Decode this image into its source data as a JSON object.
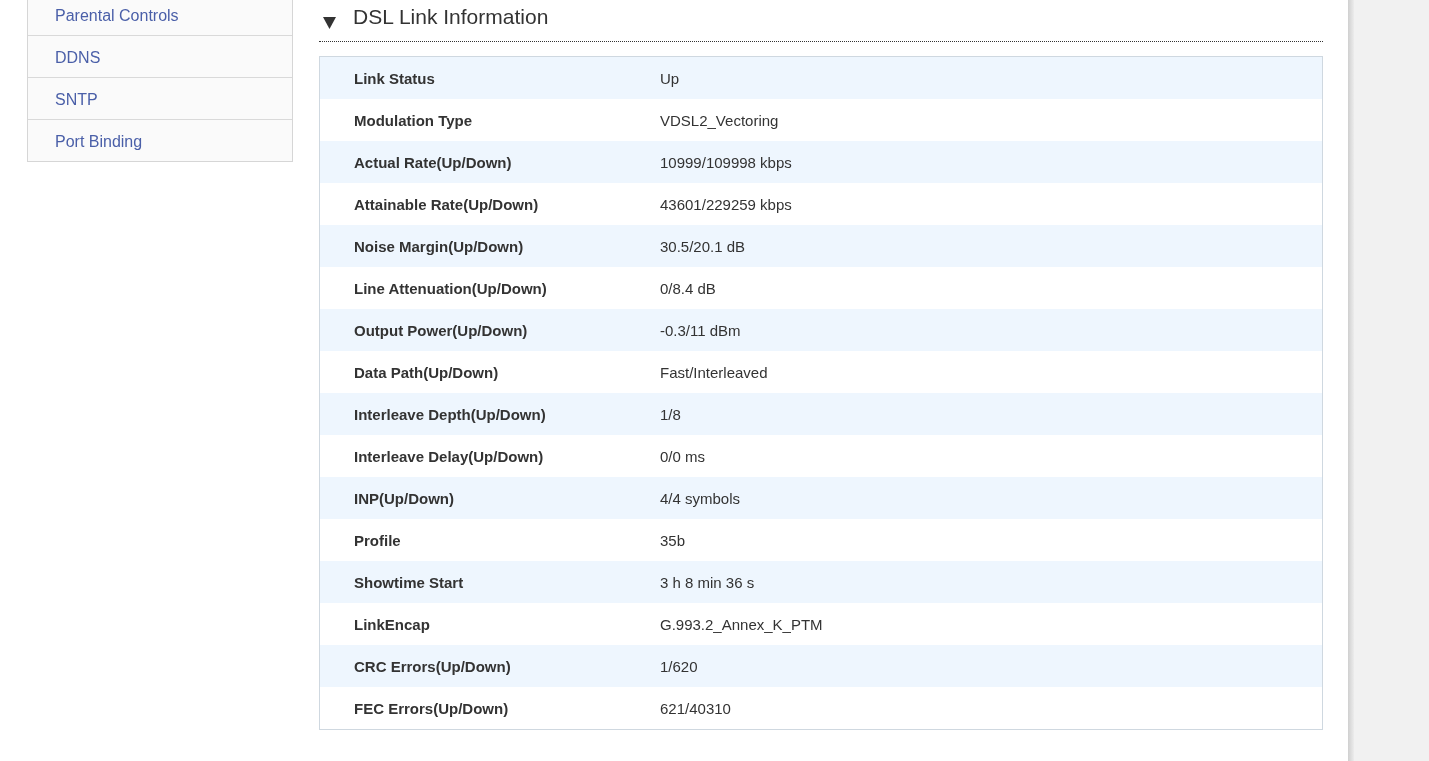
{
  "sidebar": {
    "items": [
      {
        "label": "Parental Controls",
        "selected": false
      },
      {
        "label": "DDNS",
        "selected": false
      },
      {
        "label": "SNTP",
        "selected": false
      },
      {
        "label": "Port Binding",
        "selected": false
      }
    ]
  },
  "section": {
    "title": "DSL Link Information",
    "expanded": true,
    "rows": [
      {
        "label": "Link Status",
        "value": "Up"
      },
      {
        "label": "Modulation Type",
        "value": "VDSL2_Vectoring"
      },
      {
        "label": "Actual Rate(Up/Down)",
        "value": "10999/109998 kbps"
      },
      {
        "label": "Attainable Rate(Up/Down)",
        "value": "43601/229259 kbps"
      },
      {
        "label": "Noise Margin(Up/Down)",
        "value": "30.5/20.1 dB"
      },
      {
        "label": "Line Attenuation(Up/Down)",
        "value": "0/8.4 dB"
      },
      {
        "label": "Output Power(Up/Down)",
        "value": "-0.3/11 dBm"
      },
      {
        "label": "Data Path(Up/Down)",
        "value": "Fast/Interleaved"
      },
      {
        "label": "Interleave Depth(Up/Down)",
        "value": "1/8"
      },
      {
        "label": "Interleave Delay(Up/Down)",
        "value": "0/0 ms"
      },
      {
        "label": "INP(Up/Down)",
        "value": "4/4 symbols"
      },
      {
        "label": "Profile",
        "value": "35b"
      },
      {
        "label": "Showtime Start",
        "value": "3 h 8 min 36 s"
      },
      {
        "label": "LinkEncap",
        "value": "G.993.2_Annex_K_PTM"
      },
      {
        "label": "CRC Errors(Up/Down)",
        "value": "1/620"
      },
      {
        "label": "FEC Errors(Up/Down)",
        "value": "621/40310"
      }
    ]
  }
}
